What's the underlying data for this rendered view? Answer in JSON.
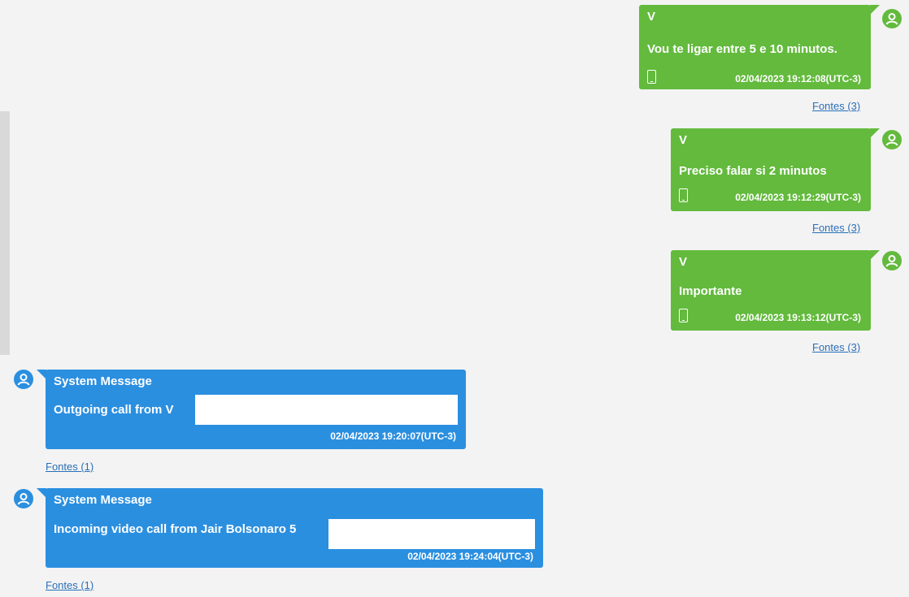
{
  "messages": [
    {
      "direction": "outgoing",
      "sender": "V",
      "text": "Vou te ligar entre 5 e 10 minutos.",
      "timestamp": "02/04/2023 19:12:08(UTC-3)",
      "sources_link": "Fontes (3)",
      "device_icon": "phone-icon"
    },
    {
      "direction": "outgoing",
      "sender": "V",
      "text": "Preciso falar si 2 minutos",
      "timestamp": "02/04/2023 19:12:29(UTC-3)",
      "sources_link": "Fontes (3)",
      "device_icon": "phone-icon"
    },
    {
      "direction": "outgoing",
      "sender": "V",
      "text": "Importante",
      "timestamp": "02/04/2023 19:13:12(UTC-3)",
      "sources_link": "Fontes (3)",
      "device_icon": "phone-icon"
    },
    {
      "direction": "incoming",
      "sender": "System Message",
      "text": "Outgoing call from V",
      "timestamp": "02/04/2023 19:20:07(UTC-3)",
      "sources_link": "Fontes (1)"
    },
    {
      "direction": "incoming",
      "sender": "System Message",
      "text": "Incoming video call from Jair Bolsonaro 5",
      "timestamp": "02/04/2023 19:24:04(UTC-3)",
      "sources_link": "Fontes (1)"
    }
  ],
  "colors": {
    "outgoing_bubble": "#63ba3d",
    "system_bubble": "#2b8fe0",
    "link": "#2a6fb8",
    "background": "#f3f3f3"
  },
  "icons": {
    "avatar": "user-avatar-icon",
    "device": "phone-icon"
  }
}
